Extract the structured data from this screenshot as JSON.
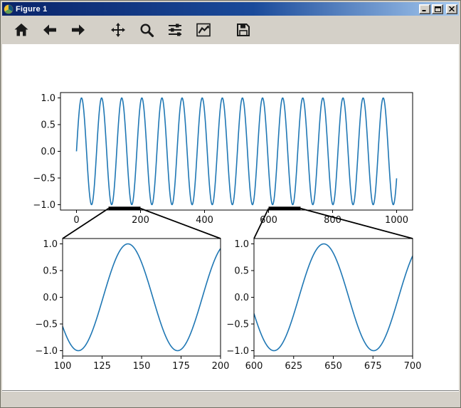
{
  "window": {
    "title": "Figure 1",
    "control_icons": [
      "minimize-icon",
      "maximize-icon",
      "close-icon"
    ]
  },
  "toolbar": {
    "icons": [
      "home-icon",
      "back-arrow-icon",
      "forward-arrow-icon",
      "pan-arrows-icon",
      "zoom-magnifier-icon",
      "subplot-sliders-icon",
      "axes-editor-chart-icon",
      "save-floppy-icon"
    ]
  },
  "statusbar": {
    "message": ""
  },
  "colors": {
    "curve": "#1f77b4",
    "chrome": "#d4d0c8",
    "titlebar_start": "#0a246a",
    "titlebar_end": "#a6caf0",
    "connector": "#000000"
  },
  "chart_data": [
    {
      "id": "main",
      "type": "line",
      "title": "",
      "xlabel": "",
      "ylabel": "",
      "xlim": [
        -50,
        1050
      ],
      "ylim": [
        -1.1,
        1.1
      ],
      "xticks": [
        0,
        200,
        400,
        600,
        800,
        1000
      ],
      "xticklabels": [
        "0",
        "200",
        "400",
        "600",
        "800",
        "1000"
      ],
      "yticks": [
        -1.0,
        -0.5,
        0.0,
        0.5,
        1.0
      ],
      "yticklabels": [
        "−1.0",
        "−0.5",
        "0.0",
        "0.5",
        "1.0"
      ],
      "line_color": "#1f77b4",
      "signal": {
        "type": "sine",
        "amplitude": 1,
        "omega": 0.1,
        "phase": 0,
        "x_start": 0,
        "x_end": 1000
      },
      "zoom_regions": [
        [
          100,
          200
        ],
        [
          600,
          700
        ]
      ],
      "zoom_marker_y": -1.07
    },
    {
      "id": "inset-left",
      "type": "line",
      "title": "",
      "xlabel": "",
      "ylabel": "",
      "xlim": [
        100,
        200
      ],
      "ylim": [
        -1.1,
        1.1
      ],
      "xticks": [
        100,
        125,
        150,
        175,
        200
      ],
      "xticklabels": [
        "100",
        "125",
        "150",
        "175",
        "200"
      ],
      "yticks": [
        -1.0,
        -0.5,
        0.0,
        0.5,
        1.0
      ],
      "yticklabels": [
        "−1.0",
        "−0.5",
        "0.0",
        "0.5",
        "1.0"
      ],
      "line_color": "#1f77b4",
      "signal": {
        "type": "sine",
        "amplitude": 1,
        "omega": 0.1,
        "phase": 0,
        "x_start": 100,
        "x_end": 200
      }
    },
    {
      "id": "inset-right",
      "type": "line",
      "title": "",
      "xlabel": "",
      "ylabel": "",
      "xlim": [
        600,
        700
      ],
      "ylim": [
        -1.1,
        1.1
      ],
      "xticks": [
        600,
        625,
        650,
        675,
        700
      ],
      "xticklabels": [
        "600",
        "625",
        "650",
        "675",
        "700"
      ],
      "yticks": [
        -1.0,
        -0.5,
        0.0,
        0.5,
        1.0
      ],
      "yticklabels": [
        "−1.0",
        "−0.5",
        "0.0",
        "0.5",
        "1.0"
      ],
      "line_color": "#1f77b4",
      "signal": {
        "type": "sine",
        "amplitude": 1,
        "omega": 0.1,
        "phase": 0,
        "x_start": 600,
        "x_end": 700
      }
    }
  ]
}
